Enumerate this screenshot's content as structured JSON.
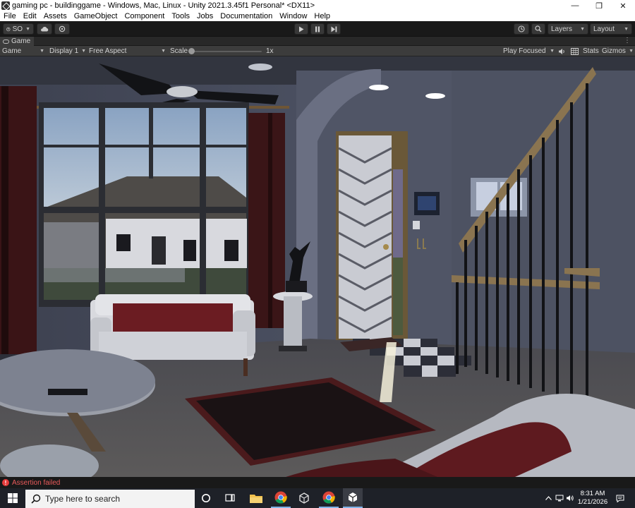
{
  "window": {
    "title": "gaming pc - buildinggame - Windows, Mac, Linux - Unity 2021.3.45f1 Personal* <DX11>",
    "minimize": "—",
    "maximize": "❐",
    "close": "✕"
  },
  "menu": [
    "File",
    "Edit",
    "Assets",
    "GameObject",
    "Component",
    "Tools",
    "Jobs",
    "Documentation",
    "Window",
    "Help"
  ],
  "toolbar": {
    "account_label": "SO",
    "layers_label": "Layers",
    "layout_label": "Layout"
  },
  "game_tab": {
    "label": "Game"
  },
  "game_bar": {
    "view_mode": "Game",
    "display": "Display 1",
    "aspect": "Free Aspect",
    "scale_label": "Scale",
    "scale_value": "1x",
    "play_mode": "Play Focused",
    "stats": "Stats",
    "gizmos": "Gizmos"
  },
  "status": {
    "message": "Assertion failed"
  },
  "taskbar": {
    "search_placeholder": "Type here to search",
    "time": "8:31 AM",
    "date": "1/21/2026"
  }
}
